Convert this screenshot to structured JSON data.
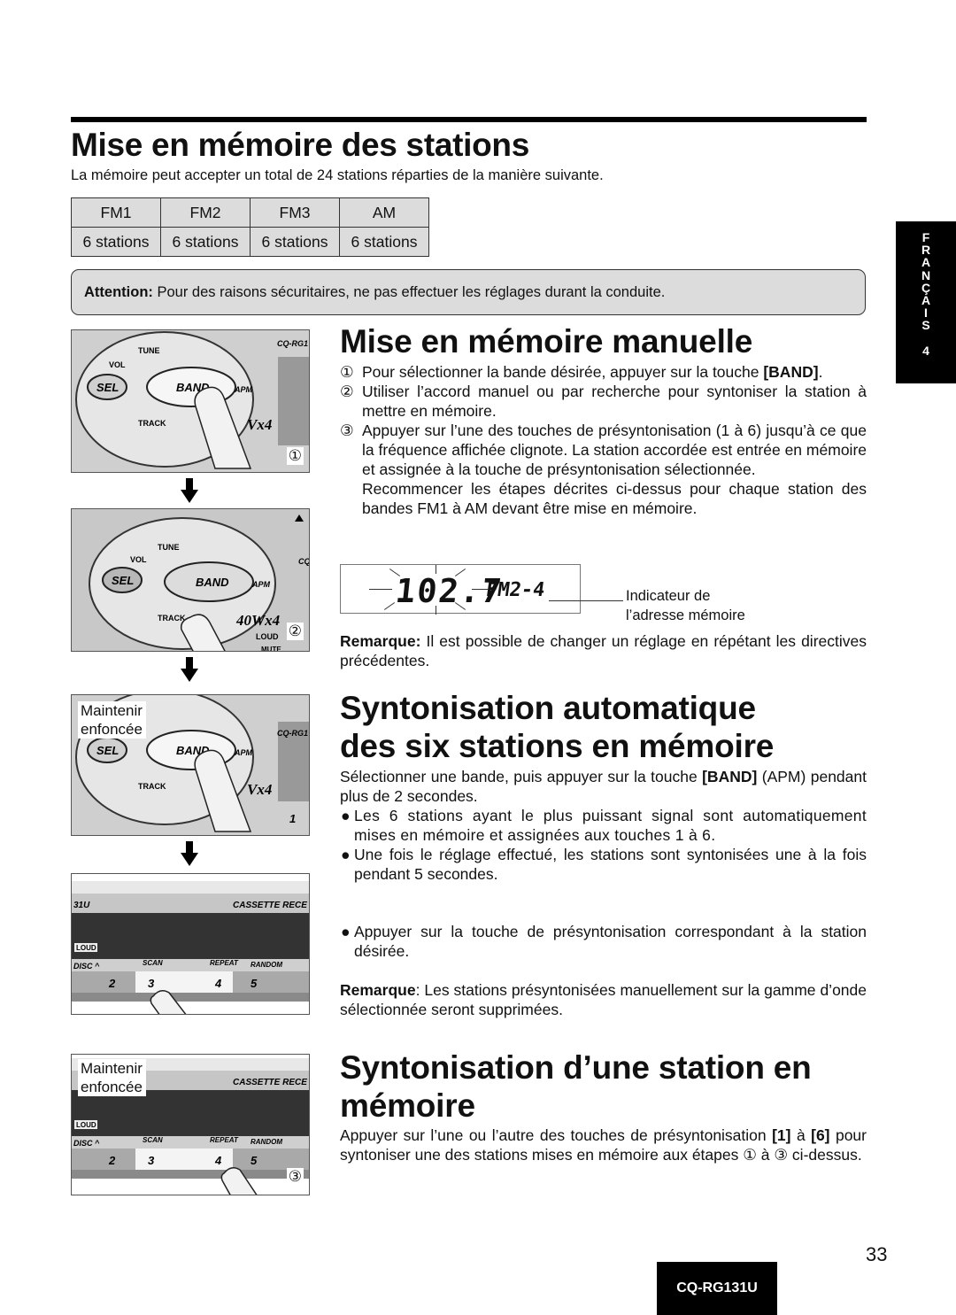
{
  "heading_main": "Mise en mémoire des stations",
  "intro": "La mémoire peut accepter un total de 24 stations réparties de la manière suivante.",
  "table": {
    "headers": [
      "FM1",
      "FM2",
      "FM3",
      "AM"
    ],
    "values": [
      "6 stations",
      "6 stations",
      "6 stations",
      "6 stations"
    ]
  },
  "attention": {
    "label": "Attention:",
    "text": " Pour des raisons sécuritaires, ne pas effectuer les réglages durant la conduite."
  },
  "side_tab": {
    "letters": [
      "F",
      "R",
      "A",
      "N",
      "Ç",
      "A",
      "I",
      "S"
    ],
    "number": "4"
  },
  "manual": {
    "title": "Mise en mémoire manuelle",
    "steps": [
      {
        "mark": "①",
        "text": "Pour sélectionner la bande désirée, appuyer sur la touche ",
        "bold": "[BAND]",
        "after": "."
      },
      {
        "mark": "②",
        "text": "Utiliser l’accord manuel ou par recherche pour syntoniser la station à mettre en mémoire."
      },
      {
        "mark": "③",
        "text": "Appuyer sur l’une des touches de présyntonisation  (1 à 6) jusqu’à ce que la fréquence affichée clignote. La station accordée est entrée en mémoire et assignée à la touche de présyntonisation sélectionnée."
      }
    ],
    "repeat": "Recommencer les étapes décrites ci-dessus pour chaque station des bandes FM1 à AM devant être mise en mémoire.",
    "display": {
      "frequency": "102.7",
      "band_indicator": "FM2-4",
      "indicator_label_line1": "Indicateur de",
      "indicator_label_line2": "l’adresse mémoire"
    },
    "note_label": "Remarque:",
    "note_text": " Il est possible de changer un réglage en répétant les directives précédentes."
  },
  "auto": {
    "title_line1": "Syntonisation automatique",
    "title_line2": "des six stations en mémoire",
    "intro_text": "Sélectionner une bande, puis appuyer sur la touche ",
    "intro_bold": "[BAND]",
    "intro_after": " (APM) pendant plus de 2 secondes.",
    "bullets": [
      "Les 6 stations ayant le plus puissant signal sont automatiquement mises en mémoire et assignées aux touches 1 à 6.",
      "Une fois le réglage effectué, les stations sont syntonisées une à la fois pendant 5 secondes.",
      "Appuyer sur la touche de présyntonisation correspondant à la station désirée."
    ],
    "bullet_glyph": "●",
    "note_label": "Remarque",
    "note_text": ": Les stations présyntonisées manuellement sur la gamme d’onde sélectionnée seront supprimées."
  },
  "single": {
    "title_line1": "Syntonisation d’une station en",
    "title_line2": "mémoire",
    "text_a": "Appuyer sur l’une ou l’autre des touches de présyntonisation ",
    "bold_1": "[1]",
    "text_b": " à ",
    "bold_6": "[6]",
    "text_c": " pour syntoniser une des stations mises en mémoire aux étapes ① à ③ ci-dessus."
  },
  "illustrations": {
    "panel_labels": {
      "vol": "VOL",
      "tune": "TUNE",
      "sel": "SEL",
      "band": "BAND",
      "apm": "APM",
      "track": "TRACK",
      "model": "CQ-RG1",
      "power": "40Wx4",
      "loud": "LOUD",
      "mute": "MUTE",
      "cassette": "CASSETTE  RECE",
      "model_tail": "31U",
      "disc": "DISC ^",
      "scan": "SCAN",
      "repeat": "REPEAT",
      "random": "RANDOM",
      "presets": [
        "2",
        "3",
        "4",
        "5"
      ],
      "preset1": "1"
    },
    "step_marks": [
      "①",
      "②",
      "③"
    ],
    "hold_callout_line1": "Maintenir",
    "hold_callout_line2": "enfoncée"
  },
  "footer": {
    "page_number": "33",
    "model": "CQ-RG131U"
  }
}
